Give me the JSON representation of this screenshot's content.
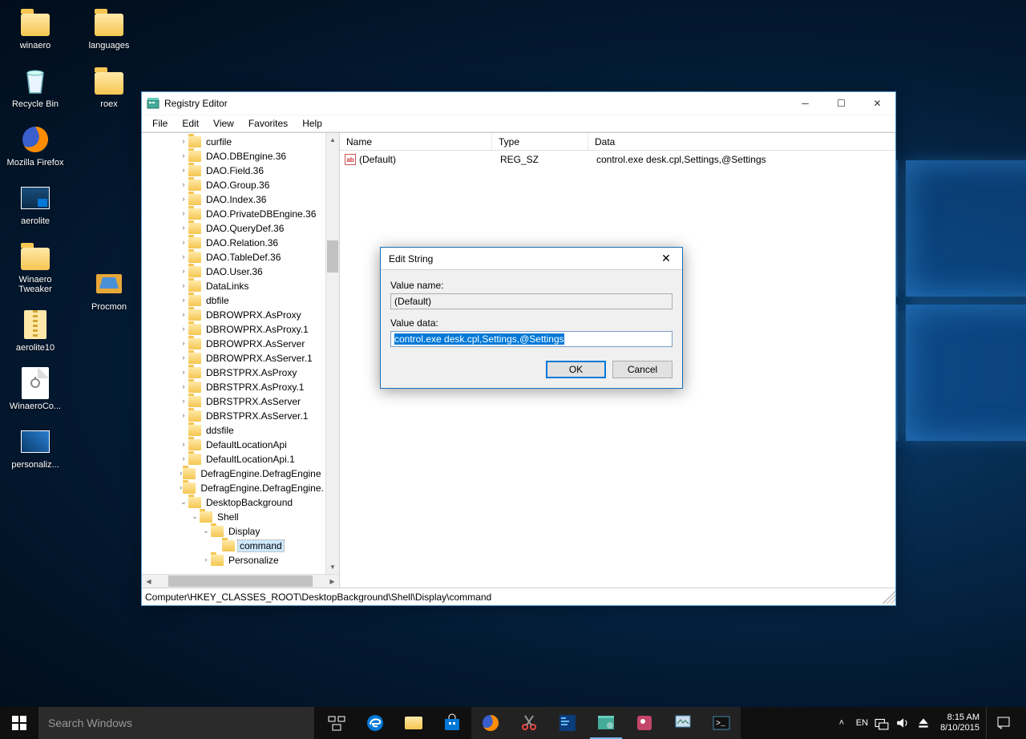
{
  "desktop": {
    "icons": [
      {
        "label": "winaero",
        "type": "folder"
      },
      {
        "label": "Recycle Bin",
        "type": "bin"
      },
      {
        "label": "Mozilla Firefox",
        "type": "firefox"
      },
      {
        "label": "aerolite",
        "type": "pic"
      },
      {
        "label": "Winaero Tweaker",
        "type": "app"
      },
      {
        "label": "aerolite10",
        "type": "zip"
      },
      {
        "label": "WinaeroCo...",
        "type": "file"
      },
      {
        "label": "personaliz...",
        "type": "pic"
      },
      {
        "label": "languages",
        "type": "folder"
      },
      {
        "label": "roex",
        "type": "folder"
      },
      {
        "label": "Procmon",
        "type": "app2"
      }
    ]
  },
  "regedit": {
    "title": "Registry Editor",
    "menu": [
      "File",
      "Edit",
      "View",
      "Favorites",
      "Help"
    ],
    "tree": [
      {
        "label": "curfile",
        "indent": 3,
        "exp": ">"
      },
      {
        "label": "DAO.DBEngine.36",
        "indent": 3,
        "exp": ">"
      },
      {
        "label": "DAO.Field.36",
        "indent": 3,
        "exp": ">"
      },
      {
        "label": "DAO.Group.36",
        "indent": 3,
        "exp": ">"
      },
      {
        "label": "DAO.Index.36",
        "indent": 3,
        "exp": ">"
      },
      {
        "label": "DAO.PrivateDBEngine.36",
        "indent": 3,
        "exp": ">"
      },
      {
        "label": "DAO.QueryDef.36",
        "indent": 3,
        "exp": ">"
      },
      {
        "label": "DAO.Relation.36",
        "indent": 3,
        "exp": ">"
      },
      {
        "label": "DAO.TableDef.36",
        "indent": 3,
        "exp": ">"
      },
      {
        "label": "DAO.User.36",
        "indent": 3,
        "exp": ">"
      },
      {
        "label": "DataLinks",
        "indent": 3,
        "exp": ">"
      },
      {
        "label": "dbfile",
        "indent": 3,
        "exp": ">"
      },
      {
        "label": "DBROWPRX.AsProxy",
        "indent": 3,
        "exp": ">"
      },
      {
        "label": "DBROWPRX.AsProxy.1",
        "indent": 3,
        "exp": ">"
      },
      {
        "label": "DBROWPRX.AsServer",
        "indent": 3,
        "exp": ">"
      },
      {
        "label": "DBROWPRX.AsServer.1",
        "indent": 3,
        "exp": ">"
      },
      {
        "label": "DBRSTPRX.AsProxy",
        "indent": 3,
        "exp": ">"
      },
      {
        "label": "DBRSTPRX.AsProxy.1",
        "indent": 3,
        "exp": ">"
      },
      {
        "label": "DBRSTPRX.AsServer",
        "indent": 3,
        "exp": ">"
      },
      {
        "label": "DBRSTPRX.AsServer.1",
        "indent": 3,
        "exp": ">"
      },
      {
        "label": "ddsfile",
        "indent": 3,
        "exp": ""
      },
      {
        "label": "DefaultLocationApi",
        "indent": 3,
        "exp": ">"
      },
      {
        "label": "DefaultLocationApi.1",
        "indent": 3,
        "exp": ">"
      },
      {
        "label": "DefragEngine.DefragEngine",
        "indent": 3,
        "exp": ">"
      },
      {
        "label": "DefragEngine.DefragEngine.",
        "indent": 3,
        "exp": ">"
      },
      {
        "label": "DesktopBackground",
        "indent": 3,
        "exp": "v"
      },
      {
        "label": "Shell",
        "indent": 4,
        "exp": "v"
      },
      {
        "label": "Display",
        "indent": 5,
        "exp": "v"
      },
      {
        "label": "command",
        "indent": 6,
        "exp": "",
        "selected": true
      },
      {
        "label": "Personalize",
        "indent": 5,
        "exp": ">"
      }
    ],
    "columns": {
      "name": "Name",
      "type": "Type",
      "data": "Data"
    },
    "values": [
      {
        "name": "(Default)",
        "type": "REG_SZ",
        "data": "control.exe desk.cpl,Settings,@Settings"
      }
    ],
    "statusbar": "Computer\\HKEY_CLASSES_ROOT\\DesktopBackground\\Shell\\Display\\command"
  },
  "dialog": {
    "title": "Edit String",
    "valuename_label": "Value name:",
    "valuename": "(Default)",
    "valuedata_label": "Value data:",
    "valuedata": "control.exe desk.cpl,Settings,@Settings",
    "ok": "OK",
    "cancel": "Cancel"
  },
  "taskbar": {
    "search_placeholder": "Search Windows",
    "lang": "EN",
    "time": "8:15 AM",
    "date": "8/10/2015"
  }
}
